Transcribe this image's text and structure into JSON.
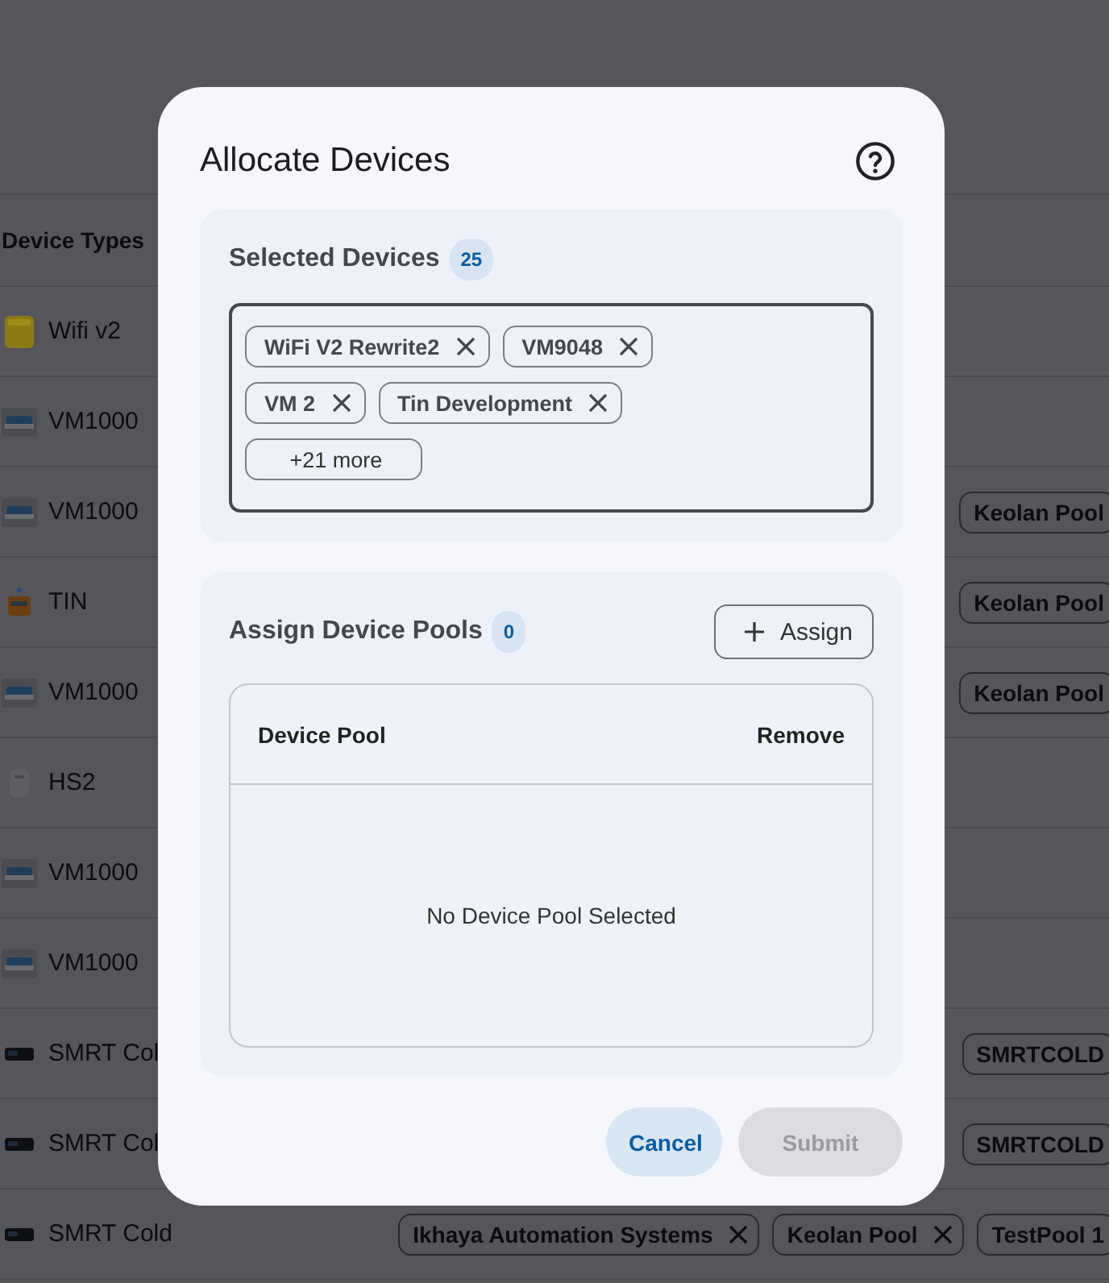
{
  "page": {
    "table": {
      "columns": [
        {
          "label": "Device Types"
        }
      ],
      "rows": [
        {
          "device_type": "Wifi v2",
          "kind": "wifi",
          "pools": []
        },
        {
          "device_type": "VM1000",
          "kind": "vm",
          "pools": []
        },
        {
          "device_type": "VM1000",
          "kind": "vm",
          "pools": [
            {
              "label": "Keolan Pool",
              "removable": false
            }
          ]
        },
        {
          "device_type": "TIN",
          "kind": "tin",
          "pools": [
            {
              "label": "Keolan Pool",
              "removable": false
            }
          ]
        },
        {
          "device_type": "VM1000",
          "kind": "vm",
          "pools": [
            {
              "label": "Keolan Pool",
              "removable": false
            }
          ]
        },
        {
          "device_type": "HS2",
          "kind": "hs",
          "pools": []
        },
        {
          "device_type": "VM1000",
          "kind": "vm",
          "pools": []
        },
        {
          "device_type": "VM1000",
          "kind": "vm",
          "pools": []
        },
        {
          "device_type": "SMRT Col",
          "kind": "smrt",
          "pools": [
            {
              "label": "SMRTCOLD",
              "removable": false
            }
          ]
        },
        {
          "device_type": "SMRT Col",
          "kind": "smrt",
          "pools": [
            {
              "label": "SMRTCOLD",
              "removable": false
            }
          ]
        },
        {
          "device_type": "SMRT Cold",
          "kind": "smrt",
          "pools": [
            {
              "label": "Ikhaya Automation Systems",
              "removable": true
            },
            {
              "label": "Keolan Pool",
              "removable": true
            },
            {
              "label": "TestPool 1",
              "removable": false
            }
          ]
        }
      ]
    }
  },
  "dialog": {
    "title": "Allocate Devices",
    "selected_devices": {
      "label": "Selected Devices",
      "count": "25",
      "chips": [
        {
          "kind": "device",
          "label": "WiFi V2 Rewrite2"
        },
        {
          "kind": "device",
          "label": "VM9048"
        },
        {
          "kind": "device",
          "label": "VM 2"
        },
        {
          "kind": "device",
          "label": "Tin Development"
        },
        {
          "kind": "more",
          "label": "+21 more"
        }
      ]
    },
    "device_pools": {
      "label": "Assign Device Pools",
      "count": "0",
      "assign_button": "Assign",
      "table": {
        "columns": [
          {
            "label": "Device Pool"
          },
          {
            "label": "Remove"
          }
        ],
        "empty_message": "No Device Pool Selected"
      }
    },
    "buttons": [
      {
        "label": "Cancel",
        "kind": "secondary",
        "disabled": false
      },
      {
        "label": "Submit",
        "kind": "primary",
        "disabled": true
      }
    ]
  }
}
